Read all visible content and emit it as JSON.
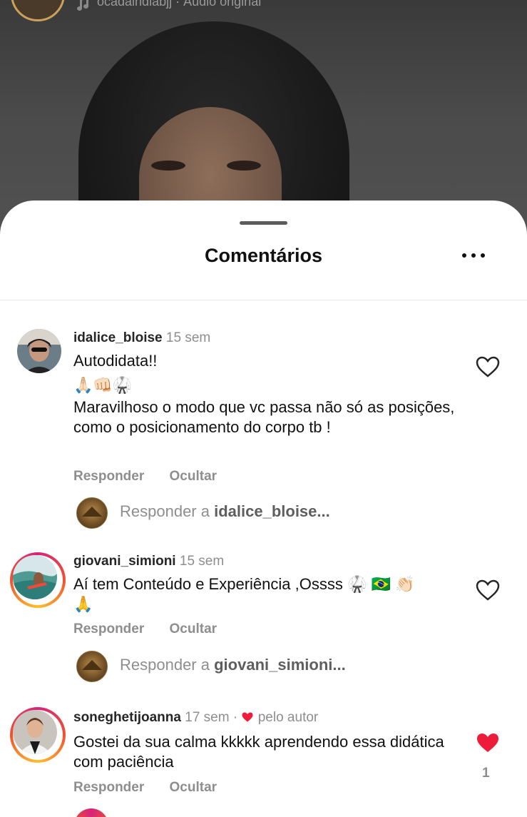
{
  "video": {
    "username": "ocadaindiabjj",
    "audio_label": "Áudio original",
    "separator": "·"
  },
  "sheet": {
    "title": "Comentários",
    "more_icon": "more-horizontal-icon"
  },
  "comments": [
    {
      "username": "idalice_bloise",
      "time": "15 sem",
      "line1": "Autodidata!!",
      "emoji_line": "🙏🏻👊🏻🥋",
      "text": "Maravilhoso o modo que vc passa não só as posições, como o posicionamento do corpo tb !",
      "reply": "Responder",
      "hide": "Ocultar",
      "liked": false,
      "reply_prompt_prefix": "Responder a",
      "reply_prompt_user": "idalice_bloise..."
    },
    {
      "username": "giovani_simioni",
      "time": "15 sem",
      "text": "Aí tem Conteúdo e Experiência ,Ossss 🥋 🇧🇷 👏🏻",
      "emoji_line": "🙏",
      "reply": "Responder",
      "hide": "Ocultar",
      "liked": false,
      "reply_prompt_prefix": "Responder a",
      "reply_prompt_user": "giovani_simioni..."
    },
    {
      "username": "soneghetijoanna",
      "time": "17 sem",
      "separator": "·",
      "author_badge": "pelo autor",
      "text": "Gostei da sua calma kkkkk aprendendo essa didática com paciência",
      "reply": "Responder",
      "hide": "Ocultar",
      "liked": true,
      "like_count": "1"
    }
  ],
  "colors": {
    "like_red": "#ed1c3b",
    "muted": "#8e8e8e",
    "story_ring": [
      "#d6247b",
      "#f0522f",
      "#fbc02d"
    ]
  }
}
